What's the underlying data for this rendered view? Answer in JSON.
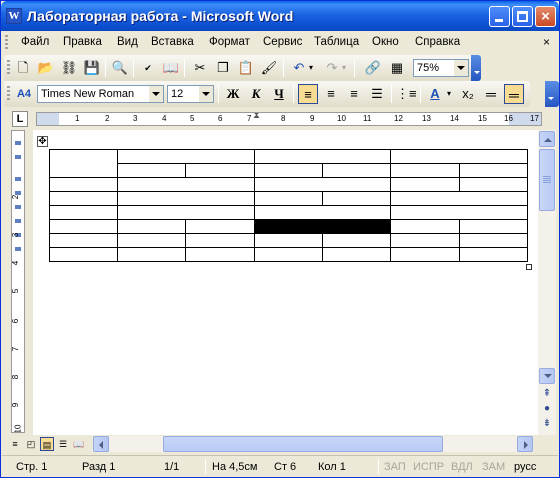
{
  "window": {
    "title": "Лабораторная работа - Microsoft Word"
  },
  "menu": {
    "items": [
      "Файл",
      "Правка",
      "Вид",
      "Вставка",
      "Формат",
      "Сервис",
      "Таблица",
      "Окно",
      "Справка"
    ],
    "close_glyph": "×"
  },
  "standard_toolbar": {
    "zoom": "75%",
    "icons": [
      "new-document-icon",
      "open-icon",
      "permission-icon",
      "save-icon",
      "print-preview-icon",
      "spelling-icon",
      "research-icon",
      "cut-icon",
      "copy-icon",
      "paste-icon",
      "format-painter-icon",
      "undo-icon",
      "redo-icon",
      "insert-hyperlink-icon",
      "tables-borders-icon"
    ]
  },
  "formatting_toolbar": {
    "styles_glyph": "A4",
    "font": "Times New Roman",
    "size": "12",
    "bold": "Ж",
    "italic": "К",
    "underline": "Ч",
    "font_color_glyph": "A",
    "subscript_glyph": "x₂"
  },
  "ruler": {
    "tab_selector": "L",
    "h_numbers": [
      "1",
      "1",
      "2",
      "3",
      "4",
      "5",
      "6",
      "7",
      "8",
      "9",
      "10",
      "11",
      "12",
      "13",
      "14",
      "15",
      "16",
      "17"
    ],
    "v_numbers": [
      "1",
      "1",
      "2",
      "3",
      "4",
      "5",
      "6",
      "7",
      "8",
      "9",
      "10"
    ]
  },
  "table": {
    "rows": 8,
    "columns": 7,
    "filled_cells": [
      {
        "row": 5,
        "col_start": 3,
        "col_span": 2
      }
    ]
  },
  "status": {
    "page": "Стр. 1",
    "section": "Разд 1",
    "pages": "1/1",
    "at": "На 4,5см",
    "line": "Ст 6",
    "col": "Кол 1",
    "rec": "ЗАП",
    "trk": "ИСПР",
    "ext": "ВДЛ",
    "ovr": "ЗАМ",
    "lang": "русс"
  },
  "colors": {
    "titlebar": "#0A5FE6",
    "chrome": "#ECE9D8",
    "active_button": "#F8DC94",
    "scroll": "#B9CBF5"
  }
}
